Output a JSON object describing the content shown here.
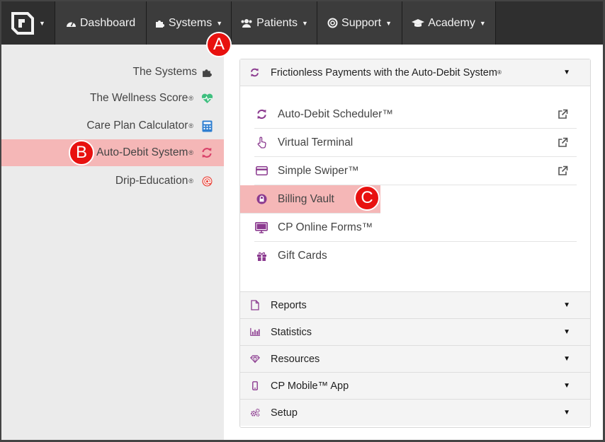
{
  "navbar": {
    "items": [
      {
        "label": "Dashboard",
        "icon": "dashboard-icon",
        "caret": ""
      },
      {
        "label": "Systems",
        "icon": "puzzle-icon",
        "caret": "▼"
      },
      {
        "label": "Patients",
        "icon": "users-icon",
        "caret": "▼"
      },
      {
        "label": "Support",
        "icon": "lifebuoy-icon",
        "caret": "▼"
      },
      {
        "label": "Academy",
        "icon": "graduation-cap-icon",
        "caret": "▼"
      }
    ],
    "logo_caret": "▼"
  },
  "sidebar": {
    "items": [
      {
        "label": "The Systems",
        "reg": "",
        "icon": "puzzle-icon"
      },
      {
        "label": "The Wellness Score",
        "reg": "®",
        "icon": "heart-pulse-icon"
      },
      {
        "label": "Care Plan Calculator",
        "reg": "®",
        "icon": "calculator-icon"
      },
      {
        "label": "Auto-Debit System",
        "reg": "®",
        "icon": "refresh-icon"
      },
      {
        "label": "Drip-Education",
        "reg": "®",
        "icon": "at-icon"
      }
    ]
  },
  "panel": {
    "title": "Frictionless Payments with the Auto-Debit System",
    "title_reg": "®",
    "caret": "▼",
    "items": [
      {
        "label": "Auto-Debit Scheduler™",
        "icon": "refresh-icon",
        "external": true
      },
      {
        "label": "Virtual Terminal",
        "icon": "hand-pointer-icon",
        "external": true
      },
      {
        "label": "Simple Swiper™",
        "icon": "credit-card-icon",
        "external": true
      },
      {
        "label": "Billing Vault",
        "icon": "lock-icon",
        "external": false
      },
      {
        "label": "CP Online Forms™",
        "icon": "monitor-icon",
        "external": false
      },
      {
        "label": "Gift Cards",
        "icon": "gift-icon",
        "external": false
      }
    ],
    "sections": [
      {
        "label": "Reports",
        "icon": "file-icon",
        "caret": "▼"
      },
      {
        "label": "Statistics",
        "icon": "bar-chart-icon",
        "caret": "▼"
      },
      {
        "label": "Resources",
        "icon": "diamond-icon",
        "caret": "▼"
      },
      {
        "label": "CP Mobile™ App",
        "icon": "mobile-icon",
        "caret": "▼"
      },
      {
        "label": "Setup",
        "icon": "cogs-icon",
        "caret": "▼"
      }
    ]
  },
  "badges": {
    "a": "A",
    "b": "B",
    "c": "C"
  },
  "colors": {
    "accent": "#8b3a8f",
    "highlight": "#f5b7b7",
    "badge": "#e8110f",
    "navbar": "#2f2f2f"
  }
}
